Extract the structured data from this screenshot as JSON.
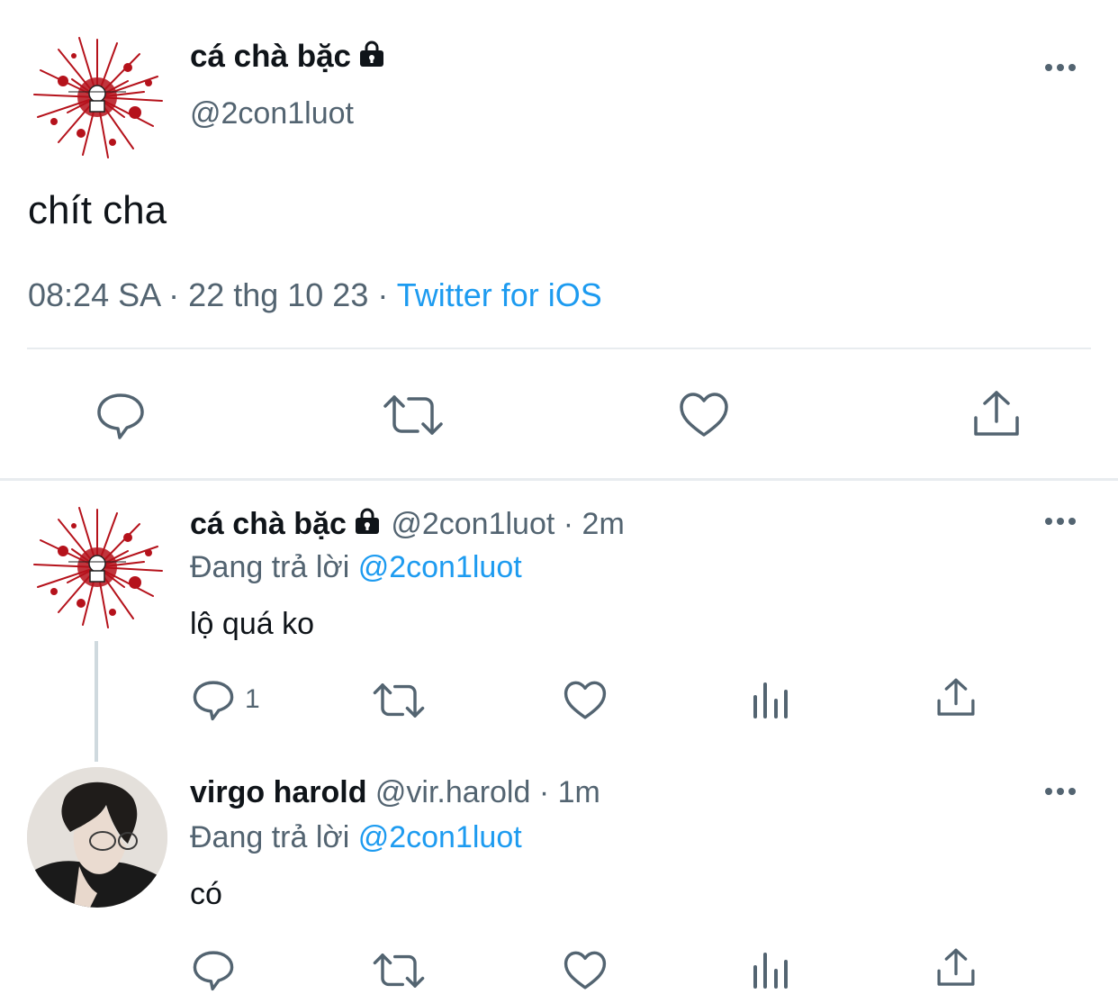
{
  "main_tweet": {
    "display_name": "cá chà bặc",
    "handle": "@2con1luot",
    "text": "chít cha",
    "time": "08:24 SA",
    "date": "22 thg 10 23",
    "separator": "·",
    "client": "Twitter for iOS",
    "actions": [
      "reply-icon",
      "retweet-icon",
      "like-icon",
      "share-icon"
    ]
  },
  "replies": [
    {
      "display_name": "cá chà bặc",
      "handle": "@2con1luot",
      "meta": "· 2m",
      "replying_prefix": "Đang trả lời",
      "replying_to": "@2con1luot",
      "text": "lộ quá ko",
      "reply_count": "1",
      "actions": [
        "reply-icon",
        "retweet-icon",
        "like-icon",
        "views-icon",
        "share-icon"
      ]
    },
    {
      "display_name": "virgo harold",
      "handle": "@vir.harold",
      "meta": "· 1m",
      "replying_prefix": "Đang trả lời",
      "replying_to": "@2con1luot",
      "text": "có",
      "actions": [
        "reply-icon",
        "retweet-icon",
        "like-icon",
        "views-icon",
        "share-icon"
      ]
    }
  ],
  "colors": {
    "link": "#1d9bf0",
    "muted": "#536471",
    "text": "#0f1419",
    "avatar_accent": "#b5121b"
  }
}
